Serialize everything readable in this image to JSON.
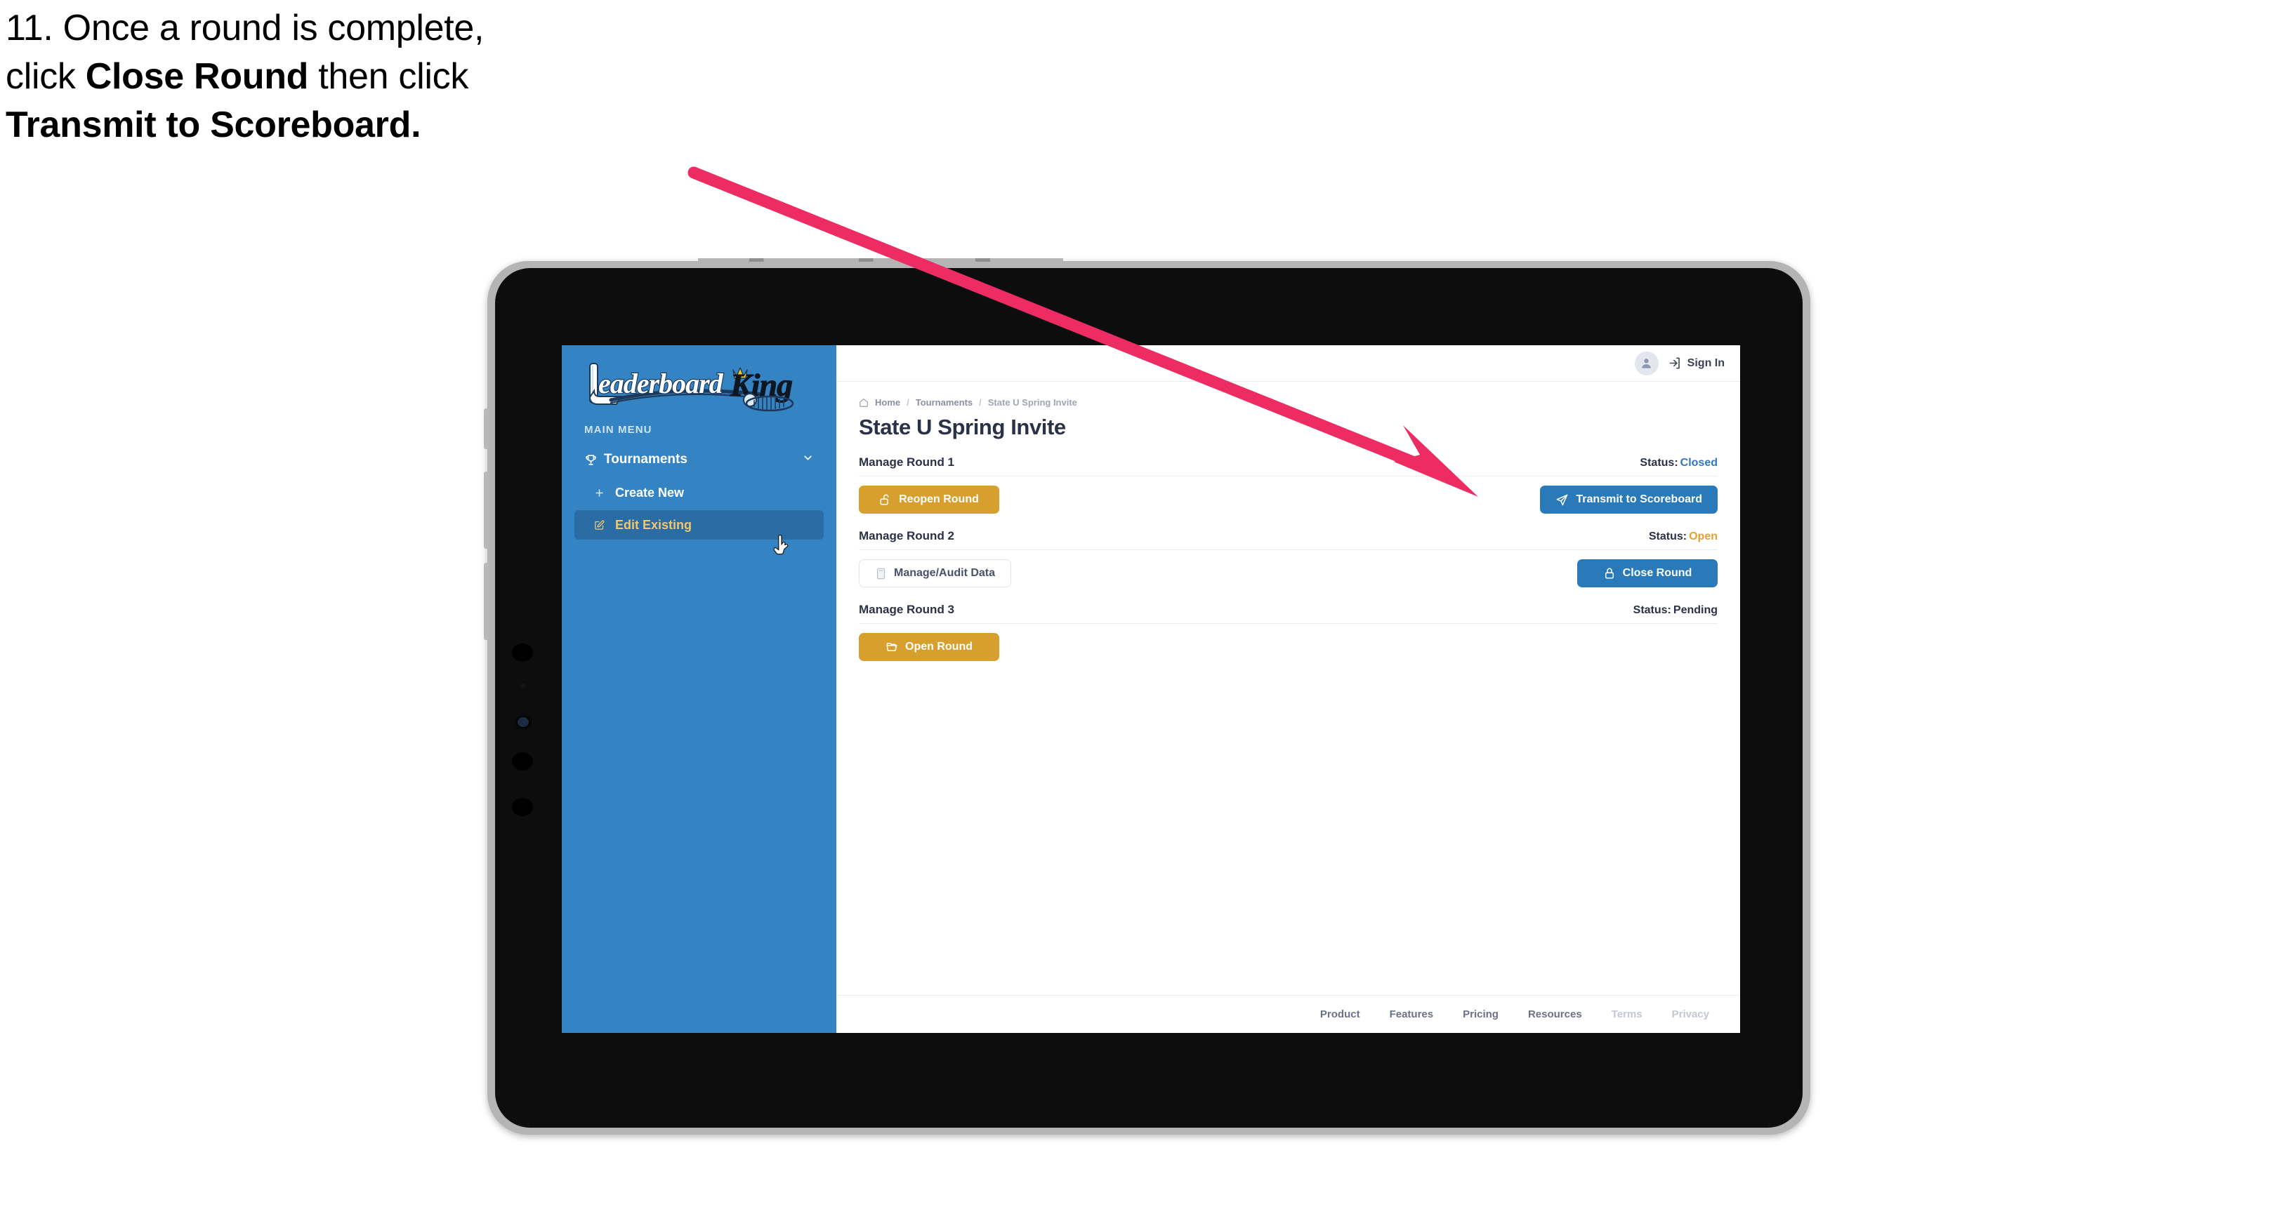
{
  "caption": {
    "lines": [
      {
        "parts": [
          {
            "t": "11. Once a round is complete,",
            "b": false
          }
        ]
      },
      {
        "parts": [
          {
            "t": "click ",
            "b": false
          },
          {
            "t": "Close Round",
            "b": true
          },
          {
            "t": " then click",
            "b": false
          }
        ]
      },
      {
        "parts": [
          {
            "t": "Transmit to Scoreboard.",
            "b": true
          }
        ]
      }
    ],
    "full_text": "11. Once a round is complete, click Close Round then click Transmit to Scoreboard."
  },
  "annotation": {
    "arrow_color": "#ed2c64",
    "points_to": "Transmit to Scoreboard"
  },
  "sidebar": {
    "logo_text": "LeaderboardKing",
    "logo_word_1": "Leaderboard",
    "logo_word_2": "King",
    "section_label": "MAIN MENU",
    "items": [
      {
        "label": "Tournaments",
        "icon": "trophy-icon",
        "chevron": "chevron-down-icon",
        "active": false
      },
      {
        "label": "Create New",
        "icon": "plus-icon",
        "active": false
      },
      {
        "label": "Edit Existing",
        "icon": "edit-square-icon",
        "active": true
      }
    ],
    "bg_color": "#3484c4",
    "active_bg_color": "#2a6ca4",
    "active_text_color": "#f0c674"
  },
  "topbar": {
    "avatar_icon": "user-avatar-icon",
    "signin_icon": "sign-in-icon",
    "signin_label": "Sign In"
  },
  "breadcrumb": {
    "home_icon": "home-icon",
    "items": [
      "Home",
      "Tournaments",
      "State U Spring Invite"
    ],
    "separator": "/"
  },
  "page": {
    "title": "State U Spring Invite"
  },
  "rounds": [
    {
      "name": "Manage Round 1",
      "status_label": "Status:",
      "status_value": "Closed",
      "status_color": "#2f78c4",
      "left_button": {
        "label": "Reopen Round",
        "icon": "unlock-icon",
        "style": "gold"
      },
      "right_button": {
        "label": "Transmit to Scoreboard",
        "icon": "paper-plane-icon",
        "style": "blue"
      }
    },
    {
      "name": "Manage Round 2",
      "status_label": "Status:",
      "status_value": "Open",
      "status_color": "#e0a32e",
      "left_button": {
        "label": "Manage/Audit Data",
        "icon": "calculator-icon",
        "style": "ghost"
      },
      "right_button": {
        "label": "Close Round",
        "icon": "lock-icon",
        "style": "blue"
      }
    },
    {
      "name": "Manage Round 3",
      "status_label": "Status:",
      "status_value": "Pending",
      "status_color": "#2b3146",
      "left_button": {
        "label": "Open Round",
        "icon": "folder-open-icon",
        "style": "gold"
      },
      "right_button": null
    }
  ],
  "footer": {
    "links": [
      {
        "label": "Product",
        "muted": false
      },
      {
        "label": "Features",
        "muted": false
      },
      {
        "label": "Pricing",
        "muted": false
      },
      {
        "label": "Resources",
        "muted": false
      },
      {
        "label": "Terms",
        "muted": true
      },
      {
        "label": "Privacy",
        "muted": true
      }
    ]
  },
  "cursor": {
    "icon": "pointing-hand-cursor"
  },
  "colors": {
    "sidebar_blue": "#3484c4",
    "button_gold": "#d7a02e",
    "button_blue": "#2a7ab9",
    "annotation_pink": "#ed2c64",
    "text_dark": "#2b3146"
  }
}
